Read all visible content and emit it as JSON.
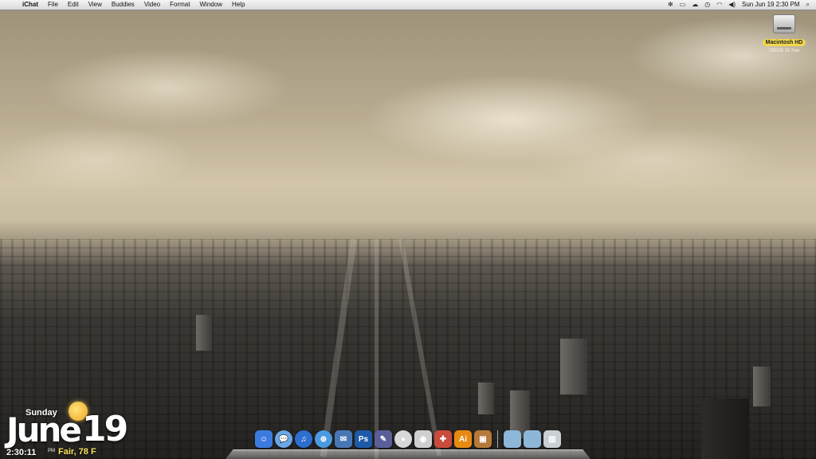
{
  "menubar": {
    "app_name": "iChat",
    "items": [
      "File",
      "Edit",
      "View",
      "Buddies",
      "Video",
      "Format",
      "Window",
      "Help"
    ],
    "clock": "Sun Jun 19  2:30 PM"
  },
  "desktop": {
    "drive": {
      "label": "Macintosh HD",
      "sub": "199GB 32 free"
    }
  },
  "widget": {
    "day": "Sunday",
    "month": "June",
    "date": "19",
    "time": "2:30:11",
    "ampm": "PM",
    "weather": "Fair, 78 F"
  },
  "dock": {
    "apps": [
      {
        "name": "Finder",
        "glyph": "☺",
        "color": "#3b7be0"
      },
      {
        "name": "iChat",
        "glyph": "💬",
        "color": "#6aa7e8"
      },
      {
        "name": "iTunes",
        "glyph": "♫",
        "color": "#2d6fd1"
      },
      {
        "name": "Safari",
        "glyph": "⊕",
        "color": "#4a9be0"
      },
      {
        "name": "Preview",
        "glyph": "✉",
        "color": "#4877b5"
      },
      {
        "name": "Photoshop",
        "glyph": "Ps",
        "color": "#1d5aa8"
      },
      {
        "name": "Brush",
        "glyph": "✎",
        "color": "#5a5f9a"
      },
      {
        "name": "DVD Player",
        "glyph": "●",
        "color": "#d8d8d8"
      },
      {
        "name": "Camera",
        "glyph": "◉",
        "color": "#cfcfcf"
      },
      {
        "name": "Toolbox",
        "glyph": "✚",
        "color": "#c84b3c"
      },
      {
        "name": "Illustrator",
        "glyph": "Ai",
        "color": "#e88a12"
      },
      {
        "name": "Photo",
        "glyph": "▣",
        "color": "#b5793a"
      }
    ],
    "stacks": [
      {
        "name": "Downloads folder",
        "glyph": "",
        "color": "#8db7d9"
      },
      {
        "name": "Documents folder",
        "glyph": "",
        "color": "#8db7d9"
      },
      {
        "name": "Trash",
        "glyph": "▥",
        "color": "#c9cfd3"
      }
    ]
  }
}
